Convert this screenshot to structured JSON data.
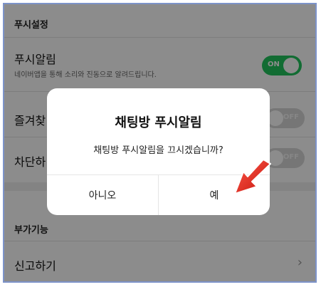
{
  "settings": {
    "section_push": "푸시설정",
    "push_alarm_title": "푸시알림",
    "push_alarm_desc": "네이버앱을 통해 소리와 진동으로 알려드립니다.",
    "push_toggle": "ON",
    "favorites_title": "즐겨찾",
    "favorites_toggle": "OFF",
    "block_title": "차단하",
    "block_toggle": "OFF",
    "section_extra": "부가기능",
    "report_title": "신고하기"
  },
  "dialog": {
    "title": "채팅방 푸시알림",
    "message": "채팅방 푸시알림을 끄시겠습니까?",
    "cancel_label": "아니오",
    "confirm_label": "예"
  },
  "colors": {
    "toggle_on": "#22c55e",
    "arrow": "#e3261c"
  }
}
